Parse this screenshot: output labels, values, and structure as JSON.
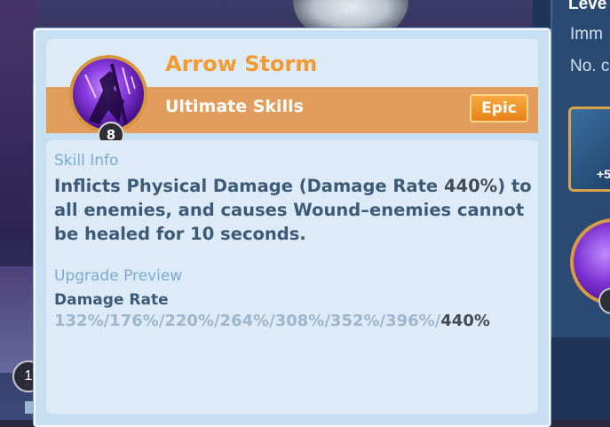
{
  "background": {
    "right_panel": {
      "level_text": "Leve",
      "immunity_text": "Imm",
      "number_text": "No. c",
      "item_count": "+5"
    },
    "bottom_left_label": "1"
  },
  "skill": {
    "name": "Arrow Storm",
    "type": "Ultimate Skills",
    "rarity": "Epic",
    "level": "8",
    "icon": "arrow-storm-icon"
  },
  "info": {
    "label": "Skill Info",
    "description_before": "Inflicts Physical Damage (Damage Rate ",
    "description_value": "440%",
    "description_after": ") to all enemies, and causes Wound–enemies cannot be healed for 10 seconds."
  },
  "upgrade": {
    "label": "Upgrade Preview",
    "stat_label": "Damage Rate",
    "preview_values": "132%/176%/220%/264%/308%/352%/396%/",
    "current_value": "440%"
  },
  "colors": {
    "title": "#f39a33",
    "header_bar": "#e29d5d",
    "epic_badge": "#e9821b",
    "label_blue": "#7fa9cf",
    "text_dark_blue": "#3f5a77",
    "card_bg": "#dcebf7"
  }
}
